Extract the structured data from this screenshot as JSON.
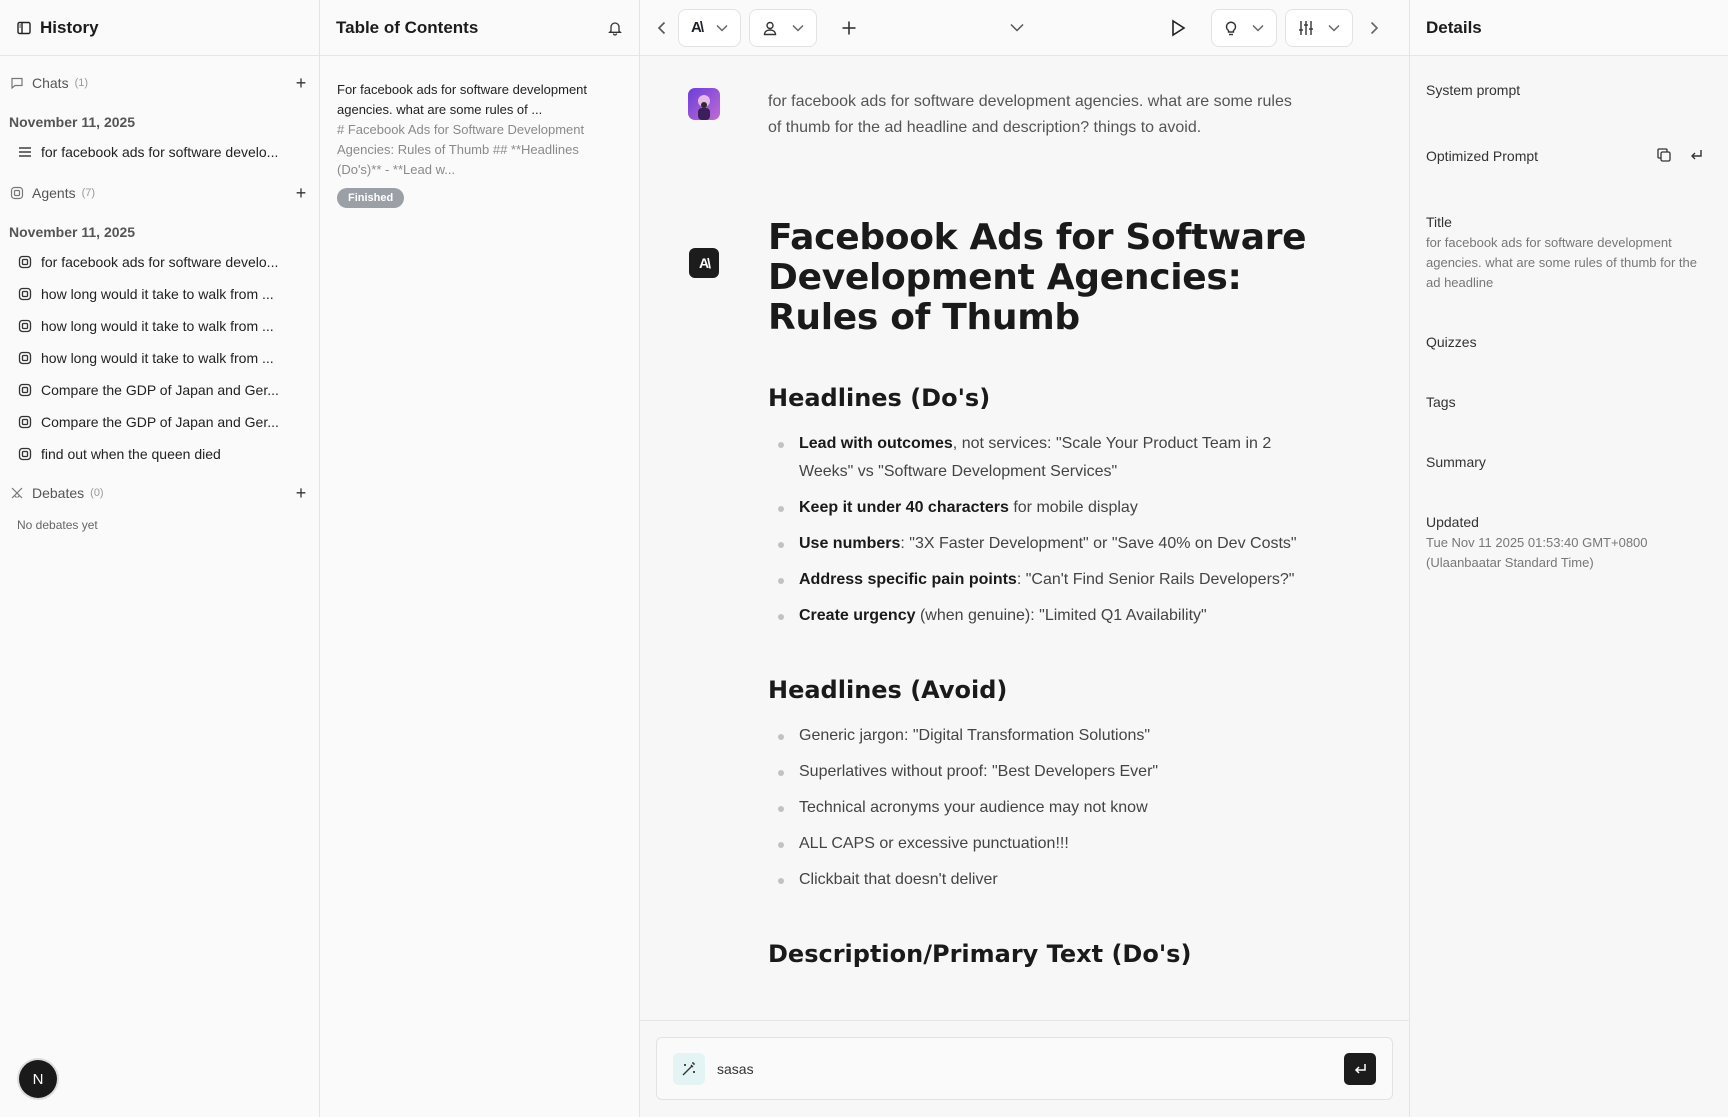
{
  "history": {
    "title": "History",
    "chats": {
      "label": "Chats",
      "count": "(1)"
    },
    "chats_date": "November 11, 2025",
    "chat_items": [
      "for facebook ads for software develo..."
    ],
    "agents": {
      "label": "Agents",
      "count": "(7)"
    },
    "agents_date": "November 11, 2025",
    "agent_items": [
      "for facebook ads for software develo...",
      "how long would it take to walk from ...",
      "how long would it take to walk from ...",
      "how long would it take to walk from ...",
      "Compare the GDP of Japan and Ger...",
      "Compare the GDP of Japan and Ger...",
      "find out when the queen died"
    ],
    "debates": {
      "label": "Debates",
      "count": "(0)"
    },
    "debates_empty": "No debates yet",
    "avatar_letter": "N"
  },
  "toc": {
    "title": "Table of Contents",
    "entry_title": "For facebook ads for software development agencies. what are some rules of ...",
    "entry_preview": "# Facebook Ads for Software Development Agencies: Rules of Thumb ## **Headlines (Do's)** - **Lead w...",
    "status": "Finished"
  },
  "main": {
    "user_message": "for facebook ads for software development agencies. what are some rules of thumb for the ad headline and description? things to avoid.",
    "ai_logo": "A\\",
    "h1": "Facebook Ads for Software Development Agencies: Rules of Thumb",
    "h2_dos": "Headlines (Do's)",
    "dos": [
      {
        "bold": "Lead with outcomes",
        "rest": ", not services: \"Scale Your Product Team in 2 Weeks\" vs \"Software Development Services\""
      },
      {
        "bold": "Keep it under 40 characters",
        "rest": " for mobile display"
      },
      {
        "bold": "Use numbers",
        "rest": ": \"3X Faster Development\" or \"Save 40% on Dev Costs\""
      },
      {
        "bold": "Address specific pain points",
        "rest": ": \"Can't Find Senior Rails Developers?\""
      },
      {
        "bold": "Create urgency",
        "rest": " (when genuine): \"Limited Q1 Availability\""
      }
    ],
    "h2_avoid": "Headlines (Avoid)",
    "avoid": [
      "Generic jargon: \"Digital Transformation Solutions\"",
      "Superlatives without proof: \"Best Developers Ever\"",
      "Technical acronyms your audience may not know",
      "ALL CAPS or excessive punctuation!!!",
      "Clickbait that doesn't deliver"
    ],
    "h2_desc": "Description/Primary Text (Do's)",
    "composer_value": "sasas"
  },
  "details": {
    "title": "Details",
    "system_prompt": "System prompt",
    "optimized_prompt": "Optimized Prompt",
    "title_label": "Title",
    "title_value": "for facebook ads for software development agencies. what are some rules of thumb for the ad headline",
    "quizzes": "Quizzes",
    "tags": "Tags",
    "summary": "Summary",
    "updated_label": "Updated",
    "updated_value": "Tue Nov 11 2025 01:53:40 GMT+0800 (Ulaanbaatar Standard Time)"
  }
}
